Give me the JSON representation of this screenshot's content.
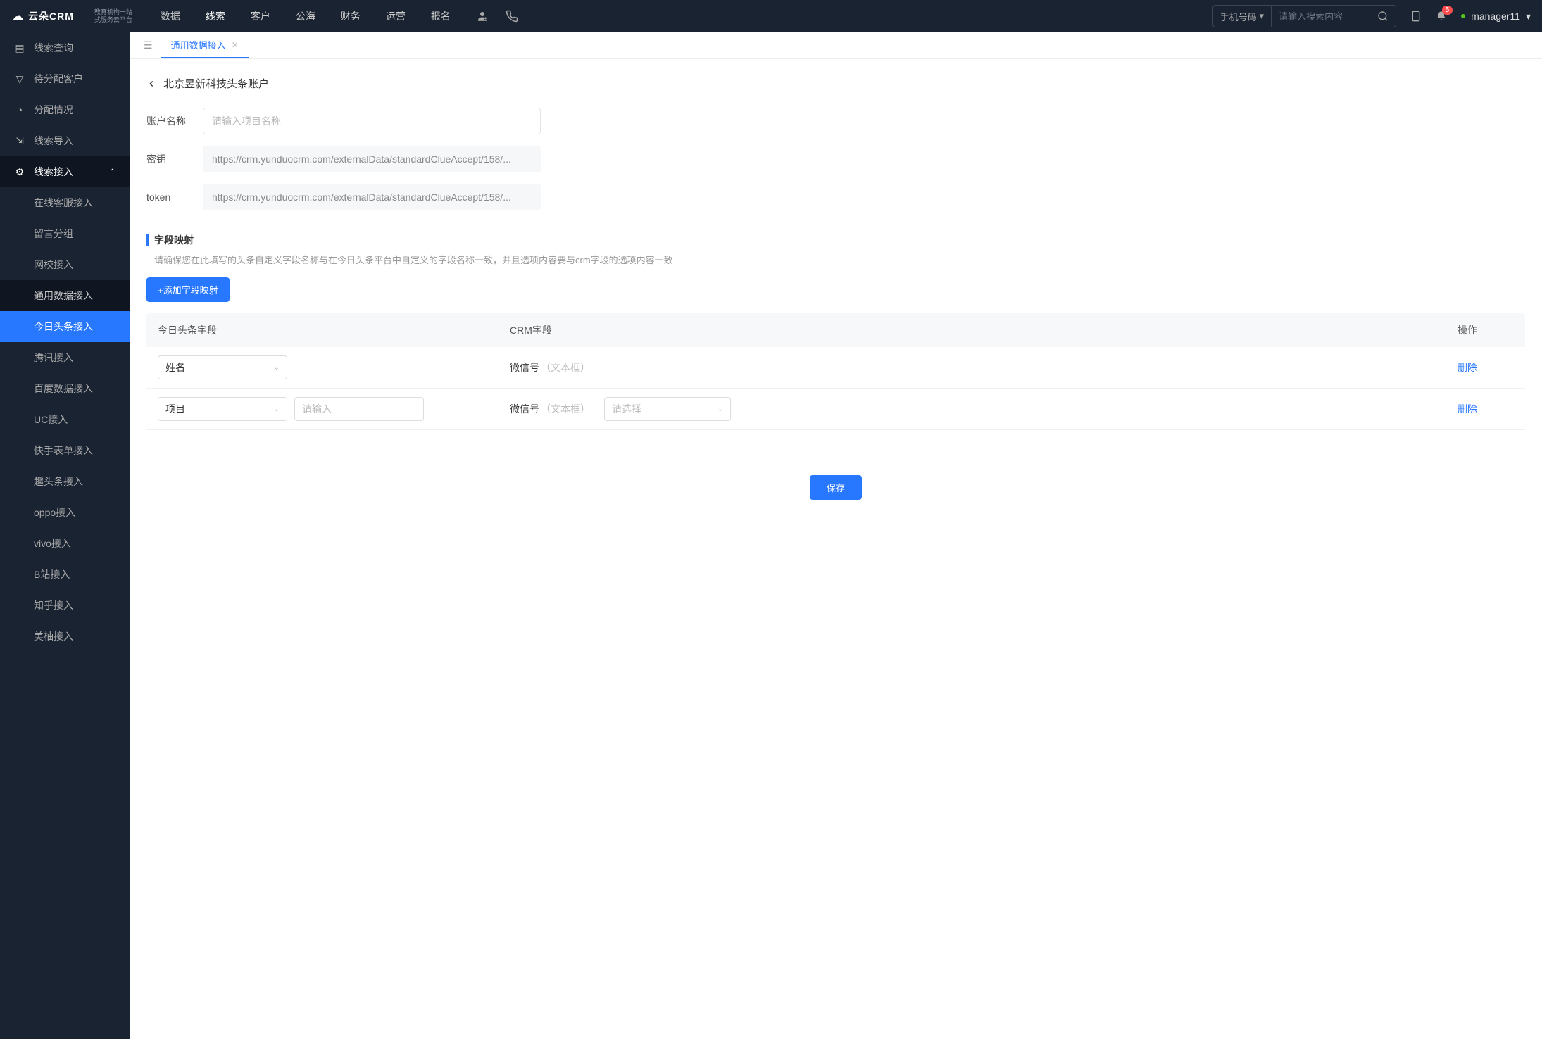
{
  "header": {
    "logo": "云朵CRM",
    "logo_sub1": "教育机构一站",
    "logo_sub2": "式服务云平台",
    "nav": [
      "数据",
      "线索",
      "客户",
      "公海",
      "财务",
      "运营",
      "报名"
    ],
    "nav_active": "线索",
    "search_type": "手机号码",
    "search_placeholder": "请输入搜索内容",
    "notification_count": "5",
    "user": "manager11"
  },
  "sidebar": {
    "items": [
      {
        "label": "线索查询"
      },
      {
        "label": "待分配客户"
      },
      {
        "label": "分配情况"
      },
      {
        "label": "线索导入"
      },
      {
        "label": "线索接入",
        "expanded": true,
        "children": [
          {
            "label": "在线客服接入"
          },
          {
            "label": "留言分组"
          },
          {
            "label": "网校接入"
          },
          {
            "label": "通用数据接入"
          },
          {
            "label": "今日头条接入",
            "active": true
          },
          {
            "label": "腾讯接入"
          },
          {
            "label": "百度数据接入"
          },
          {
            "label": "UC接入"
          },
          {
            "label": "快手表单接入"
          },
          {
            "label": "趣头条接入"
          },
          {
            "label": "oppo接入"
          },
          {
            "label": "vivo接入"
          },
          {
            "label": "B站接入"
          },
          {
            "label": "知乎接入"
          },
          {
            "label": "美柚接入"
          }
        ]
      }
    ]
  },
  "tabs": {
    "items": [
      {
        "label": "通用数据接入",
        "active": true
      }
    ]
  },
  "page": {
    "title": "北京昱新科技头条账户",
    "form": {
      "name_label": "账户名称",
      "name_placeholder": "请输入项目名称",
      "secret_label": "密钥",
      "secret_value": "https://crm.yunduocrm.com/externalData/standardClueAccept/158/...",
      "token_label": "token",
      "token_value": "https://crm.yunduocrm.com/externalData/standardClueAccept/158/..."
    },
    "mapping": {
      "title": "字段映射",
      "hint": "请确保您在此填写的头条自定义字段名称与在今日头条平台中自定义的字段名称一致，并且选项内容要与crm字段的选项内容一致",
      "add_btn": "+添加字段映射",
      "col_source": "今日头条字段",
      "col_crm": "CRM字段",
      "col_op": "操作",
      "rows": [
        {
          "source": "姓名",
          "crm": "微信号",
          "crm_type": "（文本框）",
          "delete": "删除"
        },
        {
          "source": "项目",
          "input_placeholder": "请输入",
          "crm": "微信号",
          "crm_type": "（文本框）",
          "select_placeholder": "请选择",
          "delete": "删除"
        }
      ]
    },
    "save": "保存"
  }
}
